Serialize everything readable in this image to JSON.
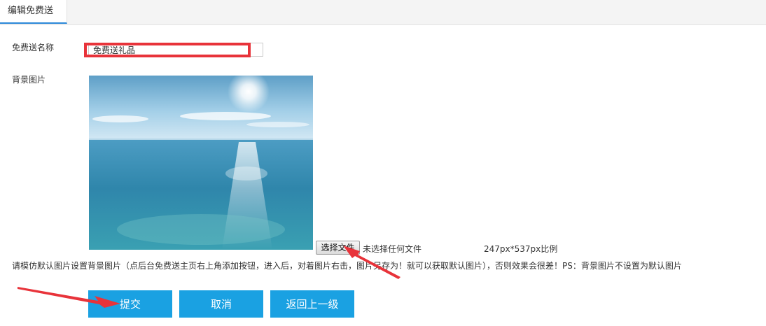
{
  "tab": {
    "label": "编辑免费送"
  },
  "form": {
    "name_label": "免费送名称",
    "name_value": "免费送礼品",
    "bg_label": "背景图片",
    "file_button": "选择文件",
    "file_status": "未选择任何文件",
    "size_hint": "247px*537px比例",
    "note": "请模仿默认图片设置背景图片（点后台免费送主页右上角添加按钮，进入后，对着图片右击，图片另存为！就可以获取默认图片），否则效果会很差！PS：背景图片不设置为默认图片"
  },
  "buttons": {
    "submit": "提交",
    "cancel": "取消",
    "back": "返回上一级"
  },
  "colors": {
    "button_blue": "#1aa1e2",
    "annotation_red": "#e8333a",
    "tab_underline": "#2b88d8"
  }
}
